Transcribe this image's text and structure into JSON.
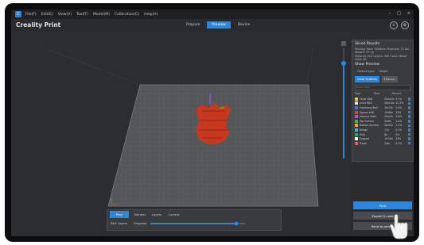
{
  "titlebar": {
    "menu": [
      "File(F)",
      "Edit(E)",
      "View(V)",
      "Tool(T)",
      "Model(M)",
      "Calibration(C)",
      "Help(H)"
    ],
    "controls": [
      "–",
      "□",
      "×"
    ]
  },
  "header": {
    "app_name": "Creality Print",
    "tabs": [
      {
        "label": "Prepare",
        "active": false
      },
      {
        "label": "Preview",
        "active": true
      },
      {
        "label": "Device",
        "active": false
      }
    ]
  },
  "colors": {
    "accent": "#2f86d8",
    "model": "#c8371f",
    "plate": "#575859"
  },
  "panel": {
    "title": "Sliced Results",
    "info_lines": [
      "Printing Time: 5h58min  Filament: 12.3m  Weight: 37.7g",
      "Material: PLA  Layers: 300  Color: Mixed  Time: 6h"
    ],
    "scheme_title": "Show Preview",
    "toggles": [
      "Feature type",
      "Height"
    ],
    "buttons": [
      {
        "label": "Color Scheme",
        "active": true
      },
      {
        "label": "Feature",
        "active": false
      }
    ],
    "search_placeholder": "Search filter",
    "table_headers": [
      "Type",
      "Time",
      "Percent"
    ],
    "rows": [
      {
        "color": "#e7c84a",
        "name": "Outer Wall",
        "time": "32m47s",
        "pct": "9.1%"
      },
      {
        "color": "#e0e0e0",
        "name": "Inner Wall",
        "time": "44m10s",
        "pct": "12.3%"
      },
      {
        "color": "#4f6fd6",
        "name": "Overhang Wall",
        "time": "3m23s",
        "pct": "0.9%"
      },
      {
        "color": "#d24a3a",
        "name": "Sparse Infill",
        "time": "1h58m",
        "pct": "33%"
      },
      {
        "color": "#c24fc4",
        "name": "Internal Solid",
        "time": "20m9s",
        "pct": "5.6%"
      },
      {
        "color": "#44b34a",
        "name": "Top Surface",
        "time": "5m6s",
        "pct": "1.4%"
      },
      {
        "color": "#f0a23a",
        "name": "Bottom Surface",
        "time": "3m52s",
        "pct": "1.1%"
      },
      {
        "color": "#36b8d8",
        "name": "Bridge",
        "time": "17s",
        "pct": "0.1%"
      },
      {
        "color": "#2fa34a",
        "name": "Skirt",
        "time": "8s",
        "pct": "0%"
      },
      {
        "color": "#f2f2f2",
        "name": "Support",
        "time": "1h23m",
        "pct": "23%"
      },
      {
        "color": "#e05a5a",
        "name": "Travel",
        "time": "24m",
        "pct": "6.7%"
      }
    ]
  },
  "bottom_bar": {
    "play_label": "Play",
    "speed_label": "Normal",
    "layers_label": "Layers",
    "current_label": "Current",
    "view_label": "Part Layers",
    "progress_label": "Progress"
  },
  "actions": {
    "primary_label": "Print",
    "export_label": "Export G-code",
    "send_label": "Send to printer"
  }
}
